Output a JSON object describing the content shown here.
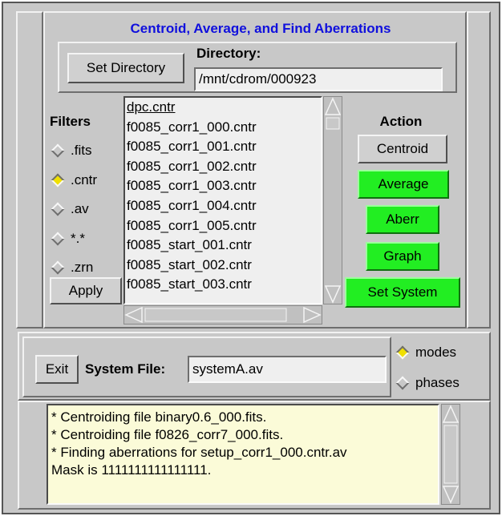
{
  "title": "Centroid, Average, and Find Aberrations",
  "directory": {
    "set_button": "Set Directory",
    "label": "Directory:",
    "value": "/mnt/cdrom/000923"
  },
  "filters": {
    "title": "Filters",
    "options": [
      {
        "label": ".fits",
        "selected": false
      },
      {
        "label": ".cntr",
        "selected": true
      },
      {
        "label": ".av",
        "selected": false
      },
      {
        "label": "*.*",
        "selected": false
      },
      {
        "label": ".zrn",
        "selected": false
      }
    ],
    "apply": "Apply"
  },
  "files": [
    "dpc.cntr",
    "f0085_corr1_000.cntr",
    "f0085_corr1_001.cntr",
    "f0085_corr1_002.cntr",
    "f0085_corr1_003.cntr",
    "f0085_corr1_004.cntr",
    "f0085_corr1_005.cntr",
    "f0085_start_001.cntr",
    "f0085_start_002.cntr",
    "f0085_start_003.cntr"
  ],
  "action": {
    "title": "Action",
    "centroid": "Centroid",
    "average": "Average",
    "aberr": "Aberr",
    "graph": "Graph",
    "set_system": "Set System"
  },
  "system": {
    "exit": "Exit",
    "label": "System File:",
    "value": "systemA.av",
    "modes": {
      "label": "modes",
      "selected": true
    },
    "phases": {
      "label": "phases",
      "selected": false
    }
  },
  "messages": [
    "* Centroiding file binary0.6_000.fits.",
    "* Centroiding file f0826_corr7_000.fits.",
    "* Finding aberrations for setup_corr1_000.cntr.av",
    "Mask is 1111111111111111."
  ],
  "colors": {
    "title": "#1010dd",
    "green_button": "#22ee22",
    "message_bg": "#fbfbd8",
    "window_bg": "#c8c8c8"
  }
}
